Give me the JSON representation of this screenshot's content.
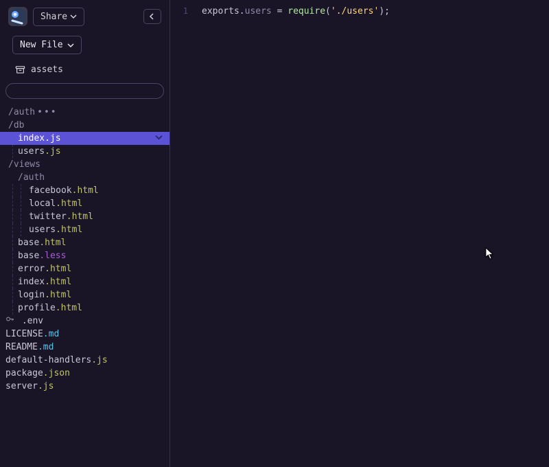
{
  "topbar": {
    "share_label": "Share"
  },
  "sidebar": {
    "newfile_label": "New File",
    "assets_label": "assets"
  },
  "search": {
    "value": "",
    "placeholder": ""
  },
  "tree": {
    "dir_auth": "/auth",
    "dots": "•••",
    "dir_db": "/db",
    "db_index_name": "index",
    "db_index_ext": ".js",
    "db_users_name": "users",
    "db_users_ext": ".js",
    "dir_views": "/views",
    "dir_views_auth": "/auth",
    "va_facebook_name": "facebook",
    "va_facebook_ext": ".html",
    "va_local_name": "local",
    "va_local_ext": ".html",
    "va_twitter_name": "twitter",
    "va_twitter_ext": ".html",
    "va_users_name": "users",
    "va_users_ext": ".html",
    "v_base_html_name": "base",
    "v_base_html_ext": ".html",
    "v_base_less_name": "base",
    "v_base_less_ext": ".less",
    "v_error_name": "error",
    "v_error_ext": ".html",
    "v_index_name": "index",
    "v_index_ext": ".html",
    "v_login_name": "login",
    "v_login_ext": ".html",
    "v_profile_name": "profile",
    "v_profile_ext": ".html",
    "root_env": ".env",
    "root_license_name": "LICENSE",
    "root_license_ext": ".md",
    "root_readme_name": "README",
    "root_readme_ext": ".md",
    "root_dh_name": "default-handlers",
    "root_dh_ext": ".js",
    "root_pkg_name": "package",
    "root_pkg_ext": ".json",
    "root_server_name": "server",
    "root_server_ext": ".js"
  },
  "editor": {
    "line_num_1": "1",
    "tok_exports": "exports",
    "tok_dot": ".",
    "tok_users": "users",
    "tok_eq": " = ",
    "tok_require": "require",
    "tok_lparen": "(",
    "tok_str": "'./users'",
    "tok_rparen": ")",
    "tok_semi": ";"
  }
}
